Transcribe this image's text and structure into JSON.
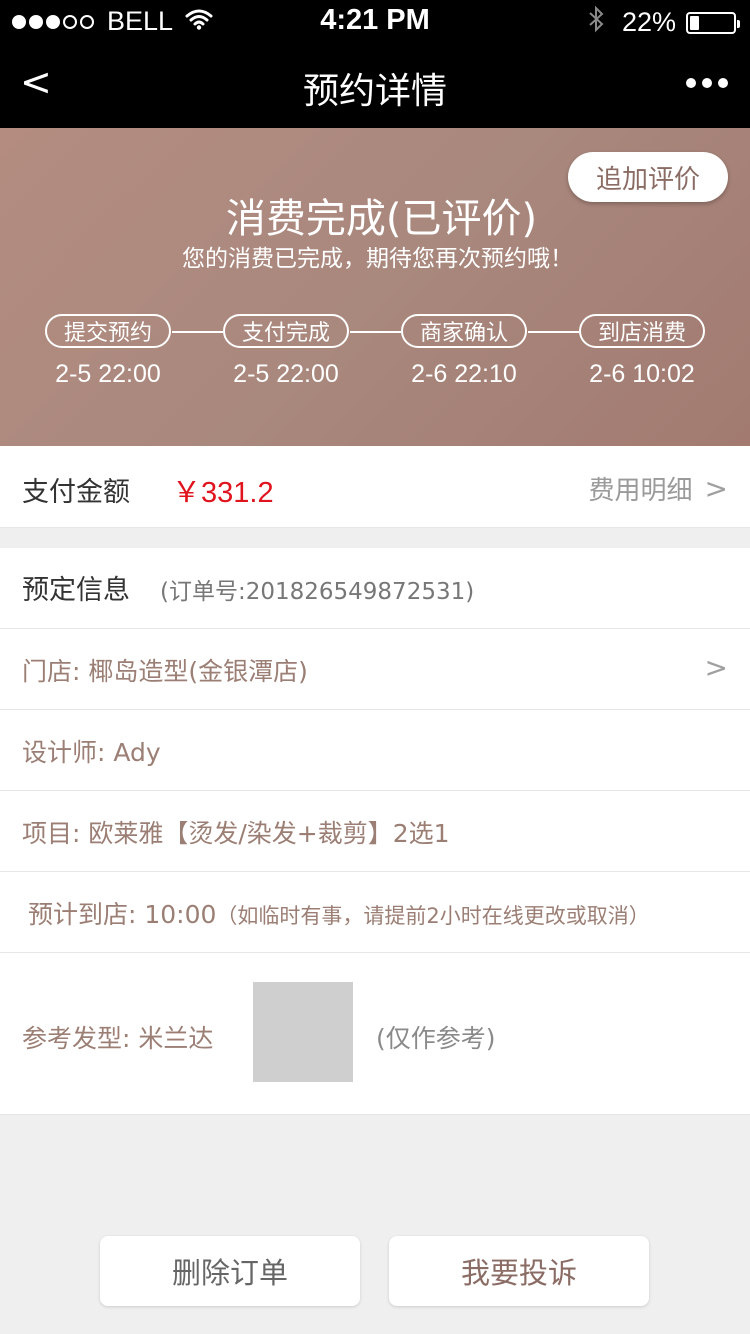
{
  "status_bar": {
    "carrier": "BELL",
    "time": "4:21 PM",
    "battery": "22%",
    "battery_level": 0.22,
    "signal_bars": 3,
    "signal_max": 5
  },
  "nav": {
    "back": "<",
    "title": "预约详情"
  },
  "header": {
    "add_review": "追加评价",
    "status_title": "消费完成(已评价)",
    "status_sub": "您的消费已完成，期待您再次预约哦！",
    "steps": [
      {
        "label": "提交预约",
        "time": "2-5 22:00"
      },
      {
        "label": "支付完成",
        "time": "2-5 22:00"
      },
      {
        "label": "商家确认",
        "time": "2-6 22:10"
      },
      {
        "label": "到店消费",
        "time": "2-6 10:02"
      }
    ]
  },
  "payment": {
    "label": "支付金额",
    "amount": "￥331.2",
    "detail": "费用明细",
    "chevron": ">"
  },
  "booking": {
    "title": "预定信息",
    "order_no": "(订单号:201826549872531)",
    "store": "门店: 椰岛造型(金银潭店)",
    "store_chevron": ">",
    "designer": "设计师: Ady",
    "item": "项目: 欧莱雅【烫发/染发+裁剪】2选1",
    "arrival": "预计到店: 10:00",
    "arrival_note": "（如临时有事，请提前2小时在线更改或取消）",
    "reference": "参考发型: 米兰达",
    "reference_note": "(仅作参考)"
  },
  "buttons": {
    "delete": "删除订单",
    "complain": "我要投诉"
  }
}
